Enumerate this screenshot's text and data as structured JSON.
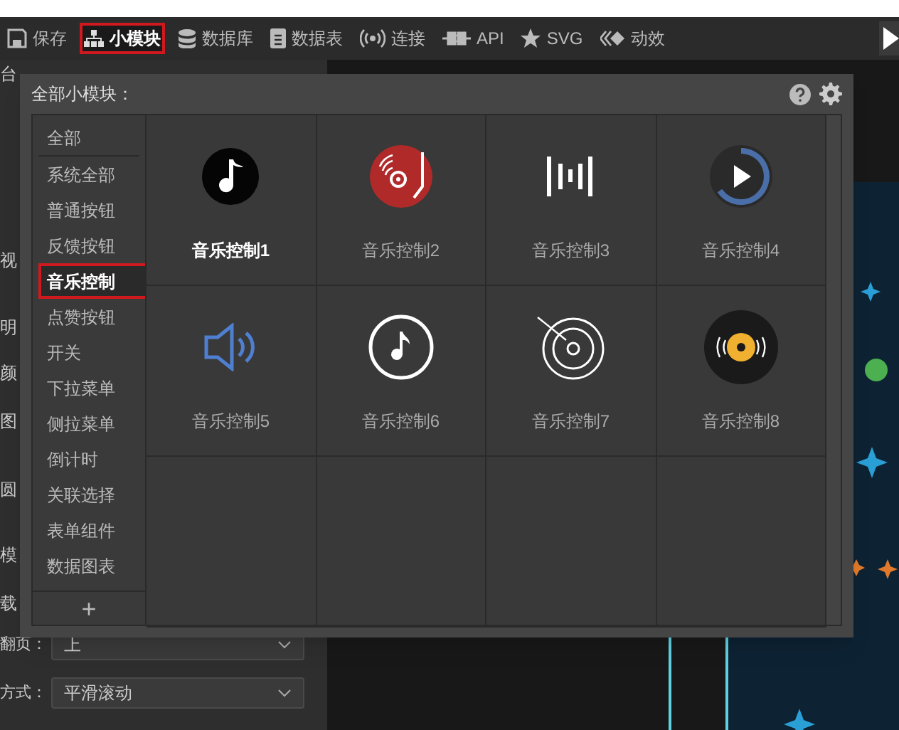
{
  "toolbar": {
    "items": [
      {
        "label": "保存",
        "selected": false,
        "highlighted": false
      },
      {
        "label": "小模块",
        "selected": true,
        "highlighted": true
      },
      {
        "label": "数据库",
        "selected": false,
        "highlighted": false
      },
      {
        "label": "数据表",
        "selected": false,
        "highlighted": false
      },
      {
        "label": "连接",
        "selected": false,
        "highlighted": false
      },
      {
        "label": "API",
        "selected": false,
        "highlighted": false
      },
      {
        "label": "SVG",
        "selected": false,
        "highlighted": false
      },
      {
        "label": "动效",
        "selected": false,
        "highlighted": false
      }
    ]
  },
  "left_panel": {
    "labels": [
      "台",
      "视",
      "明",
      "颜",
      "图",
      "圆",
      "模",
      "载"
    ],
    "fields": [
      {
        "label": "翻页：",
        "value": "上"
      },
      {
        "label": "方式：",
        "value": "平滑滚动"
      }
    ]
  },
  "popup": {
    "title": "全部小模块：",
    "categories": [
      {
        "label": "全部",
        "selected": false,
        "highlighted": false
      },
      {
        "label": "系统全部",
        "selected": false,
        "highlighted": false
      },
      {
        "label": "普通按钮",
        "selected": false,
        "highlighted": false
      },
      {
        "label": "反馈按钮",
        "selected": false,
        "highlighted": false
      },
      {
        "label": "音乐控制",
        "selected": true,
        "highlighted": true
      },
      {
        "label": "点赞按钮",
        "selected": false,
        "highlighted": false
      },
      {
        "label": "开关",
        "selected": false,
        "highlighted": false
      },
      {
        "label": "下拉菜单",
        "selected": false,
        "highlighted": false
      },
      {
        "label": "侧拉菜单",
        "selected": false,
        "highlighted": false
      },
      {
        "label": "倒计时",
        "selected": false,
        "highlighted": false
      },
      {
        "label": "关联选择",
        "selected": false,
        "highlighted": false
      },
      {
        "label": "表单组件",
        "selected": false,
        "highlighted": false
      },
      {
        "label": "数据图表",
        "selected": false,
        "highlighted": false
      }
    ],
    "add_button": "+",
    "modules": [
      {
        "label": "音乐控制1",
        "selected": true
      },
      {
        "label": "音乐控制2",
        "selected": false
      },
      {
        "label": "音乐控制3",
        "selected": false
      },
      {
        "label": "音乐控制4",
        "selected": false
      },
      {
        "label": "音乐控制5",
        "selected": false
      },
      {
        "label": "音乐控制6",
        "selected": false
      },
      {
        "label": "音乐控制7",
        "selected": false
      },
      {
        "label": "音乐控制8",
        "selected": false
      }
    ]
  }
}
